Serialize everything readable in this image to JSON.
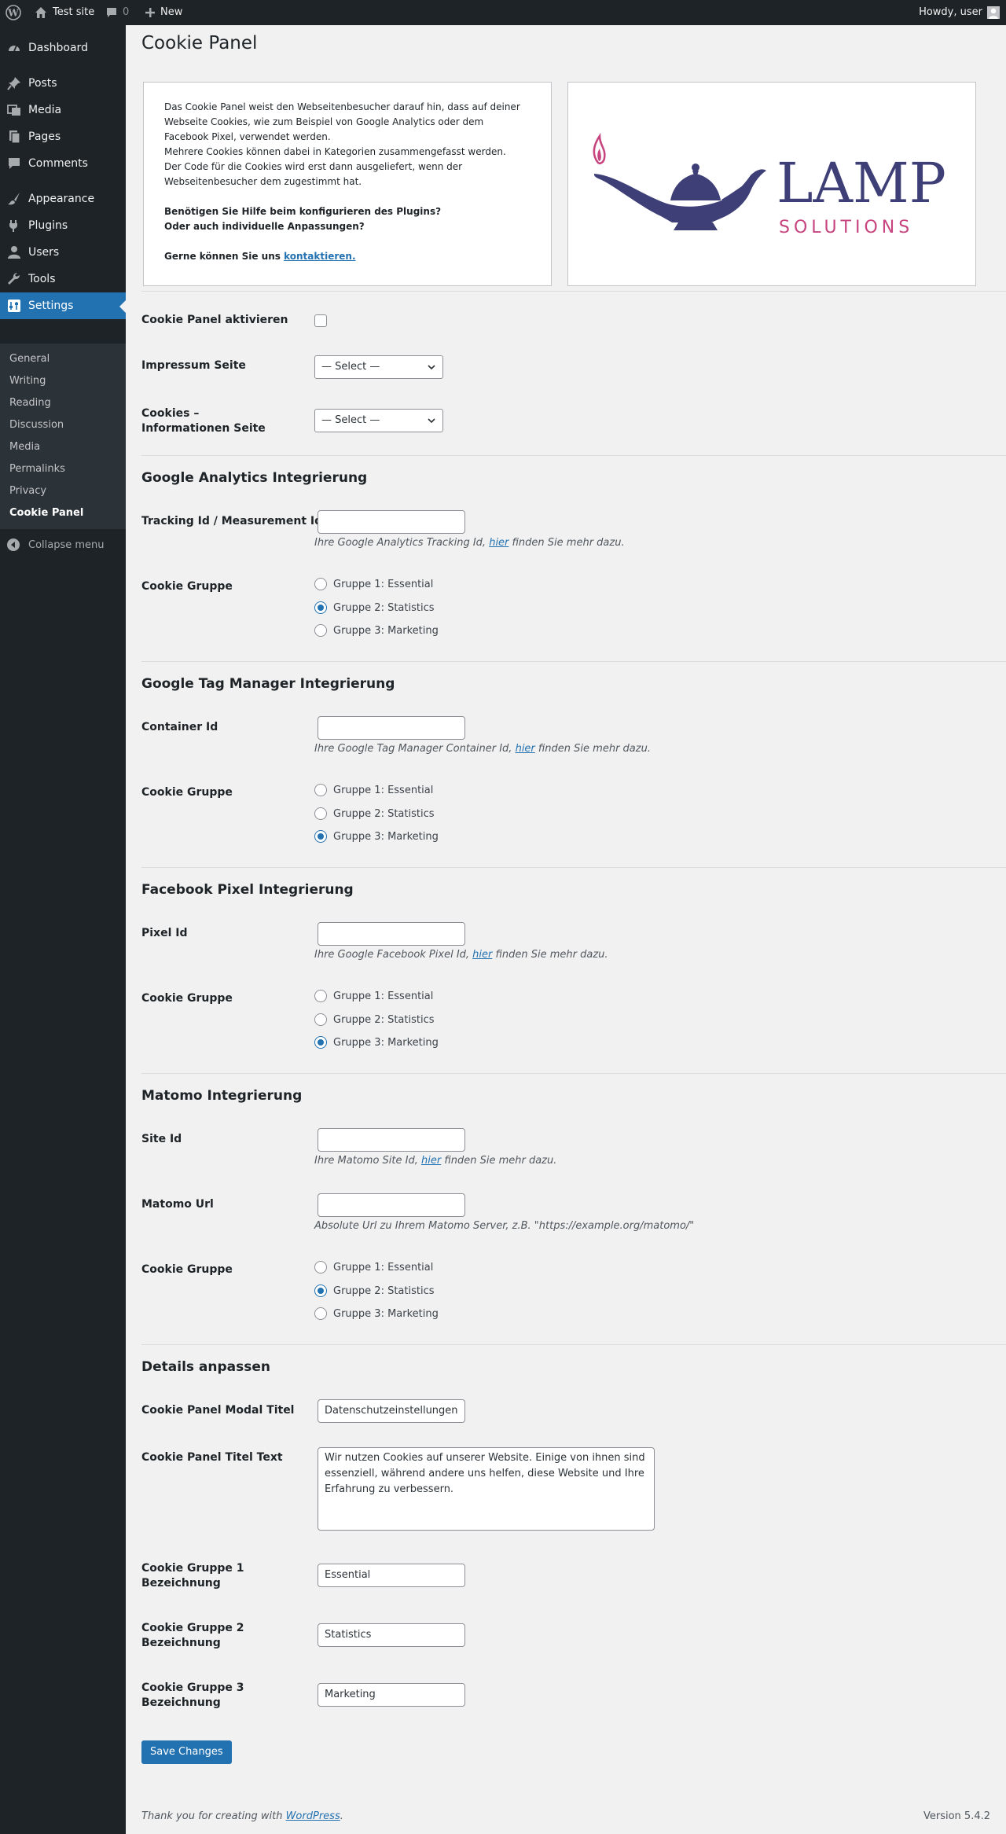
{
  "adminbar": {
    "site_name": "Test site",
    "comments_count": "0",
    "new_label": "New",
    "howdy": "Howdy, user"
  },
  "sidebar": {
    "items": [
      {
        "label": "Dashboard",
        "icon": "dashboard-icon"
      },
      {
        "label": "Posts",
        "icon": "pin-icon"
      },
      {
        "label": "Media",
        "icon": "media-icon"
      },
      {
        "label": "Pages",
        "icon": "page-icon"
      },
      {
        "label": "Comments",
        "icon": "comment-icon"
      },
      {
        "label": "Appearance",
        "icon": "brush-icon"
      },
      {
        "label": "Plugins",
        "icon": "plug-icon"
      },
      {
        "label": "Users",
        "icon": "user-icon"
      },
      {
        "label": "Tools",
        "icon": "wrench-icon"
      },
      {
        "label": "Settings",
        "icon": "settings-icon"
      }
    ],
    "submenu": [
      "General",
      "Writing",
      "Reading",
      "Discussion",
      "Media",
      "Permalinks",
      "Privacy",
      "Cookie Panel"
    ],
    "collapse": "Collapse menu"
  },
  "page": {
    "title": "Cookie Panel"
  },
  "intro": {
    "p1": "Das Cookie Panel weist den Webseitenbesucher darauf hin, dass auf deiner Webseite Cookies, wie zum Beispiel von Google Analytics oder dem Facebook Pixel, verwendet werden.",
    "p2": "Mehrere Cookies können dabei in Kategorien zusammengefasst werden.",
    "p3": "Der Code für die Cookies wird erst dann ausgeliefert, wenn der Webseitenbesucher dem zugestimmt hat.",
    "help1": "Benötigen Sie Hilfe beim konfigurieren des Plugins?",
    "help2": "Oder auch individuelle Anpassungen?",
    "contact_prefix": "Gerne können Sie uns ",
    "contact_link": "kontaktieren."
  },
  "logo": {
    "word": "LAMP",
    "sub": "SOLUTIONS",
    "navy": "#3f3f78",
    "pink": "#c7447f"
  },
  "general": {
    "activate_label": "Cookie Panel aktivieren",
    "impressum_label": "Impressum Seite",
    "impressum_value": "— Select —",
    "cookies_info_label": "Cookies – Informationen Seite",
    "cookies_info_value": "— Select —"
  },
  "ga": {
    "title": "Google Analytics Integrierung",
    "field_label": "Tracking Id / Measurement Id",
    "field_value": "",
    "desc_prefix": "Ihre Google Analytics Tracking Id, ",
    "desc_link": "hier",
    "desc_suffix": " finden Sie mehr dazu.",
    "group_label": "Cookie Gruppe",
    "selected": 1
  },
  "gtm": {
    "title": "Google Tag Manager Integrierung",
    "field_label": "Container Id",
    "field_value": "",
    "desc_prefix": "Ihre Google Tag Manager Container Id, ",
    "desc_link": "hier",
    "desc_suffix": " finden Sie mehr dazu.",
    "group_label": "Cookie Gruppe",
    "selected": 2
  },
  "fb": {
    "title": "Facebook Pixel Integrierung",
    "field_label": "Pixel Id",
    "field_value": "",
    "desc_prefix": "Ihre Google Facebook Pixel Id, ",
    "desc_link": "hier",
    "desc_suffix": " finden Sie mehr dazu.",
    "group_label": "Cookie Gruppe",
    "selected": 2
  },
  "matomo": {
    "title": "Matomo Integrierung",
    "site_label": "Site Id",
    "site_value": "",
    "site_desc_prefix": "Ihre Matomo Site Id, ",
    "site_desc_link": "hier",
    "site_desc_suffix": " finden Sie mehr dazu.",
    "url_label": "Matomo Url",
    "url_value": "",
    "url_desc": "Absolute Url zu Ihrem Matomo Server, z.B. \"https://example.org/matomo/\"",
    "group_label": "Cookie Gruppe",
    "selected": 1
  },
  "groups": [
    "Gruppe 1: Essential",
    "Gruppe 2: Statistics",
    "Gruppe 3: Marketing"
  ],
  "details": {
    "title": "Details anpassen",
    "modal_title_label": "Cookie Panel Modal Titel",
    "modal_title_value": "Datenschutzeinstellungen",
    "title_text_label": "Cookie Panel Titel Text",
    "title_text_value": "Wir nutzen Cookies auf unserer Website. Einige von ihnen sind essenziell, während andere uns helfen, diese Website und Ihre Erfahrung zu verbessern.",
    "g1_label": "Cookie Gruppe 1 Bezeichnung",
    "g1_value": "Essential",
    "g2_label": "Cookie Gruppe 2 Bezeichnung",
    "g2_value": "Statistics",
    "g3_label": "Cookie Gruppe 3 Bezeichnung",
    "g3_value": "Marketing"
  },
  "save_label": "Save Changes",
  "footer": {
    "thanks_prefix": "Thank you for creating with ",
    "thanks_link": "WordPress",
    "thanks_suffix": ".",
    "version": "Version 5.4.2"
  }
}
